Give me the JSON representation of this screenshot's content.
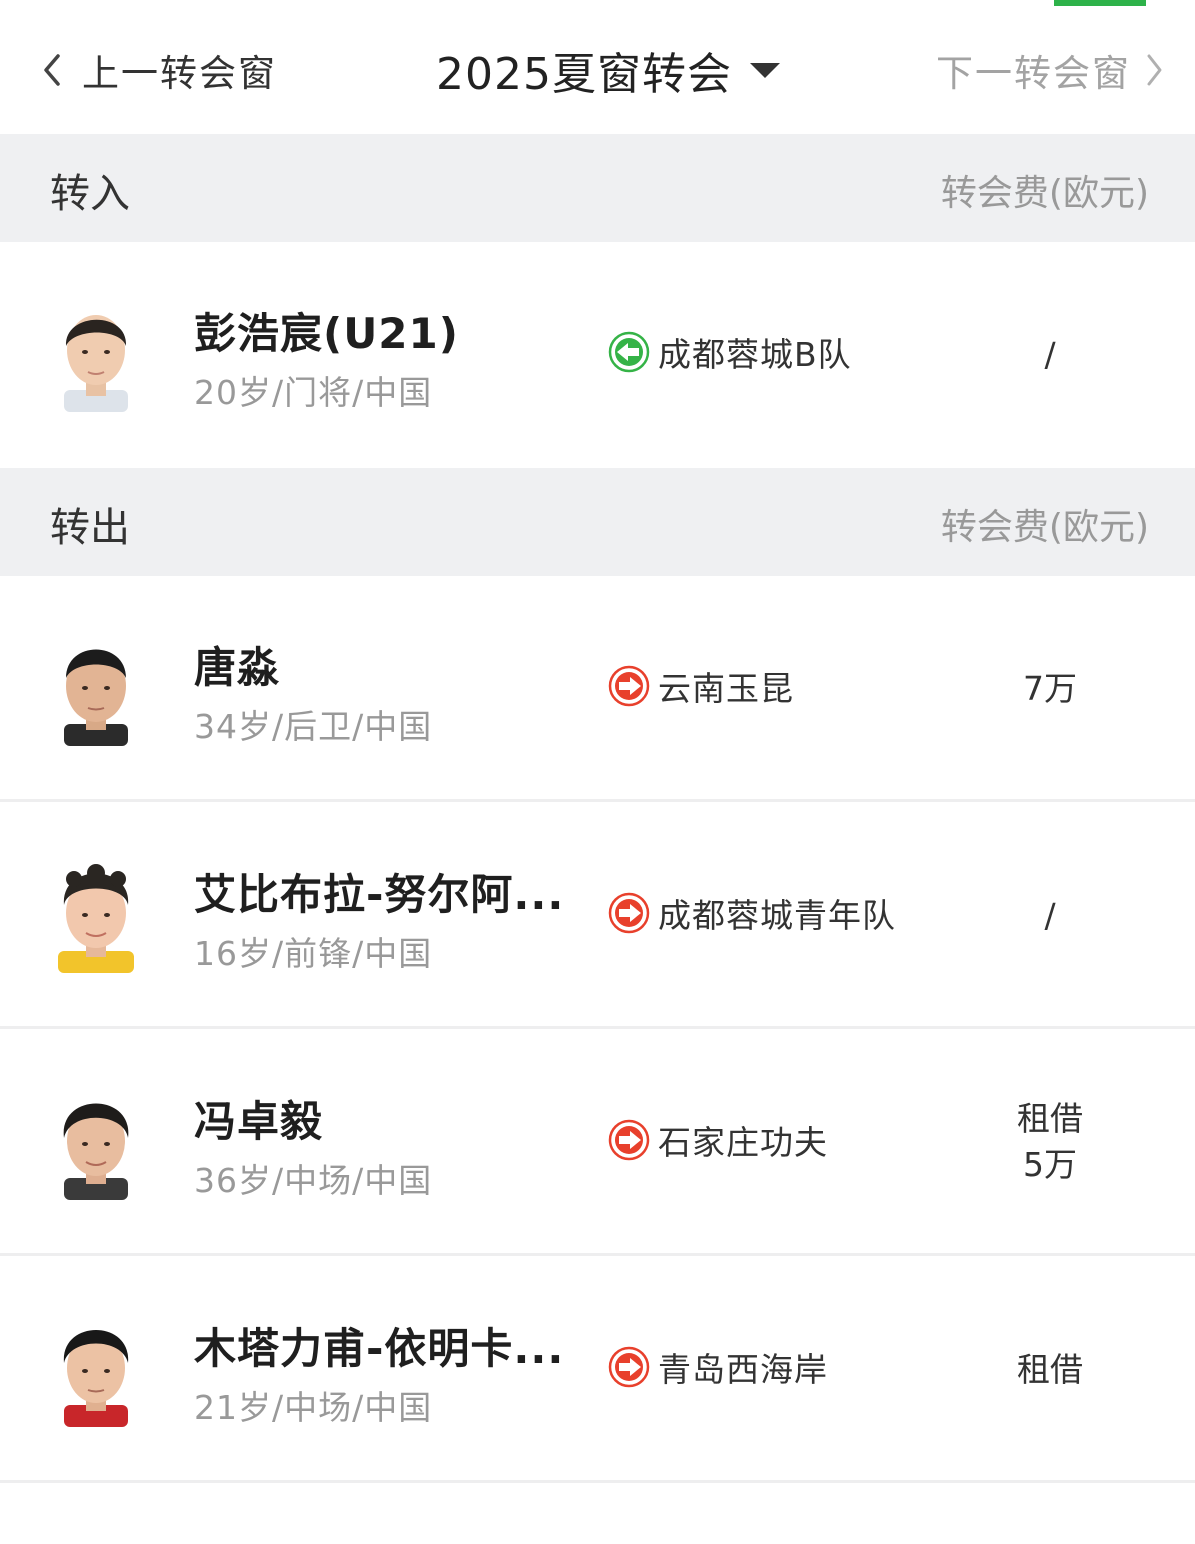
{
  "nav": {
    "prev_label": "上一转会窗",
    "title": "2025夏窗转会",
    "next_label": "下一转会窗"
  },
  "colors": {
    "accent_green": "#2eb24a",
    "in_arrow": "#35b347",
    "out_arrow": "#e8402c"
  },
  "transfers_in": {
    "title": "转入",
    "fee_header": "转会费(欧元)",
    "players": [
      {
        "name": "彭浩宸(U21)",
        "info": "20岁/门将/中国",
        "club": "成都蓉城B队",
        "direction": "in",
        "fee": "/",
        "fee_line2": ""
      }
    ]
  },
  "transfers_out": {
    "title": "转出",
    "fee_header": "转会费(欧元)",
    "players": [
      {
        "name": "唐淼",
        "info": "34岁/后卫/中国",
        "club": "云南玉昆",
        "direction": "out",
        "fee": "7万",
        "fee_line2": ""
      },
      {
        "name": "艾比布拉-努尔阿...",
        "info": "16岁/前锋/中国",
        "club": "成都蓉城青年队",
        "direction": "out",
        "fee": "/",
        "fee_line2": ""
      },
      {
        "name": "冯卓毅",
        "info": "36岁/中场/中国",
        "club": "石家庄功夫",
        "direction": "out",
        "fee": "租借",
        "fee_line2": "5万"
      },
      {
        "name": "木塔力甫-依明卡...",
        "info": "21岁/中场/中国",
        "club": "青岛西海岸",
        "direction": "out",
        "fee": "租借",
        "fee_line2": ""
      }
    ]
  }
}
